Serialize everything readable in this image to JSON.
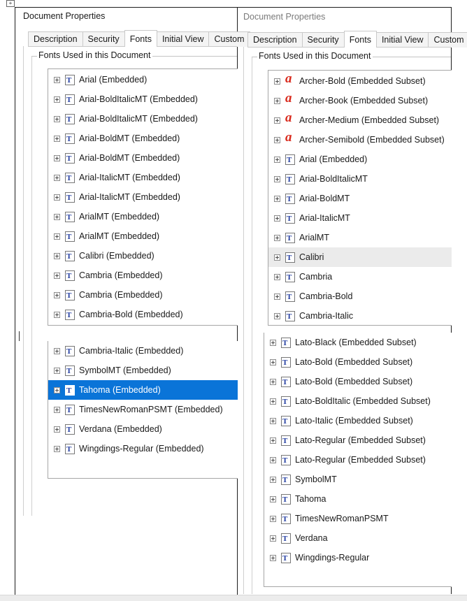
{
  "left_dialog": {
    "title": "Document Properties",
    "tabs": [
      "Description",
      "Security",
      "Fonts",
      "Initial View",
      "Custom"
    ],
    "active_tab": "Fonts",
    "group_label": "Fonts Used in this Document",
    "fonts_top": [
      {
        "name": "Arial (Embedded)"
      },
      {
        "name": "Arial-BoldItalicMT (Embedded)"
      },
      {
        "name": "Arial-BoldItalicMT (Embedded)"
      },
      {
        "name": "Arial-BoldMT (Embedded)"
      },
      {
        "name": "Arial-BoldMT (Embedded)"
      },
      {
        "name": "Arial-ItalicMT (Embedded)"
      },
      {
        "name": "Arial-ItalicMT (Embedded)"
      },
      {
        "name": "ArialMT (Embedded)"
      },
      {
        "name": "ArialMT (Embedded)"
      },
      {
        "name": "Calibri (Embedded)"
      },
      {
        "name": "Cambria (Embedded)"
      },
      {
        "name": "Cambria (Embedded)"
      },
      {
        "name": "Cambria-Bold (Embedded)"
      }
    ],
    "fonts_bottom": [
      {
        "name": "Cambria-Italic (Embedded)"
      },
      {
        "name": "SymbolMT (Embedded)"
      },
      {
        "name": "Tahoma (Embedded)",
        "selected": true
      },
      {
        "name": "TimesNewRomanPSMT (Embedded)"
      },
      {
        "name": "Verdana (Embedded)"
      },
      {
        "name": "Wingdings-Regular (Embedded)"
      }
    ]
  },
  "right_dialog": {
    "title": "Document Properties",
    "tabs": [
      "Description",
      "Security",
      "Fonts",
      "Initial View",
      "Custom"
    ],
    "active_tab": "Fonts",
    "group_label": "Fonts Used in this Document",
    "fonts_top": [
      {
        "name": "Archer-Bold (Embedded Subset)",
        "icon": "type1"
      },
      {
        "name": "Archer-Book (Embedded Subset)",
        "icon": "type1"
      },
      {
        "name": "Archer-Medium (Embedded Subset)",
        "icon": "type1"
      },
      {
        "name": "Archer-Semibold (Embedded Subset)",
        "icon": "type1"
      },
      {
        "name": "Arial (Embedded)",
        "icon": "truetype"
      },
      {
        "name": "Arial-BoldItalicMT",
        "icon": "truetype"
      },
      {
        "name": "Arial-BoldMT",
        "icon": "truetype"
      },
      {
        "name": "Arial-ItalicMT",
        "icon": "truetype"
      },
      {
        "name": "ArialMT",
        "icon": "truetype"
      },
      {
        "name": "Calibri",
        "icon": "truetype",
        "hover": true
      },
      {
        "name": "Cambria",
        "icon": "truetype"
      },
      {
        "name": "Cambria-Bold",
        "icon": "truetype"
      },
      {
        "name": "Cambria-Italic",
        "icon": "truetype"
      }
    ],
    "fonts_bottom": [
      {
        "name": "Lato-Black (Embedded Subset)",
        "icon": "truetype"
      },
      {
        "name": "Lato-Bold (Embedded Subset)",
        "icon": "truetype"
      },
      {
        "name": "Lato-Bold (Embedded Subset)",
        "icon": "truetype"
      },
      {
        "name": "Lato-BoldItalic (Embedded Subset)",
        "icon": "truetype"
      },
      {
        "name": "Lato-Italic (Embedded Subset)",
        "icon": "truetype"
      },
      {
        "name": "Lato-Regular (Embedded Subset)",
        "icon": "truetype"
      },
      {
        "name": "Lato-Regular (Embedded Subset)",
        "icon": "truetype"
      },
      {
        "name": "SymbolMT",
        "icon": "truetype"
      },
      {
        "name": "Tahoma",
        "icon": "truetype"
      },
      {
        "name": "TimesNewRomanPSMT",
        "icon": "truetype"
      },
      {
        "name": "Verdana",
        "icon": "truetype"
      },
      {
        "name": "Wingdings-Regular",
        "icon": "truetype"
      }
    ]
  },
  "icons": {
    "truetype_glyph": "T",
    "type1_glyph": "a",
    "selection_color": "#0a74d8",
    "type1_color": "#d9291c",
    "truetype_color": "#1f3aa0"
  }
}
